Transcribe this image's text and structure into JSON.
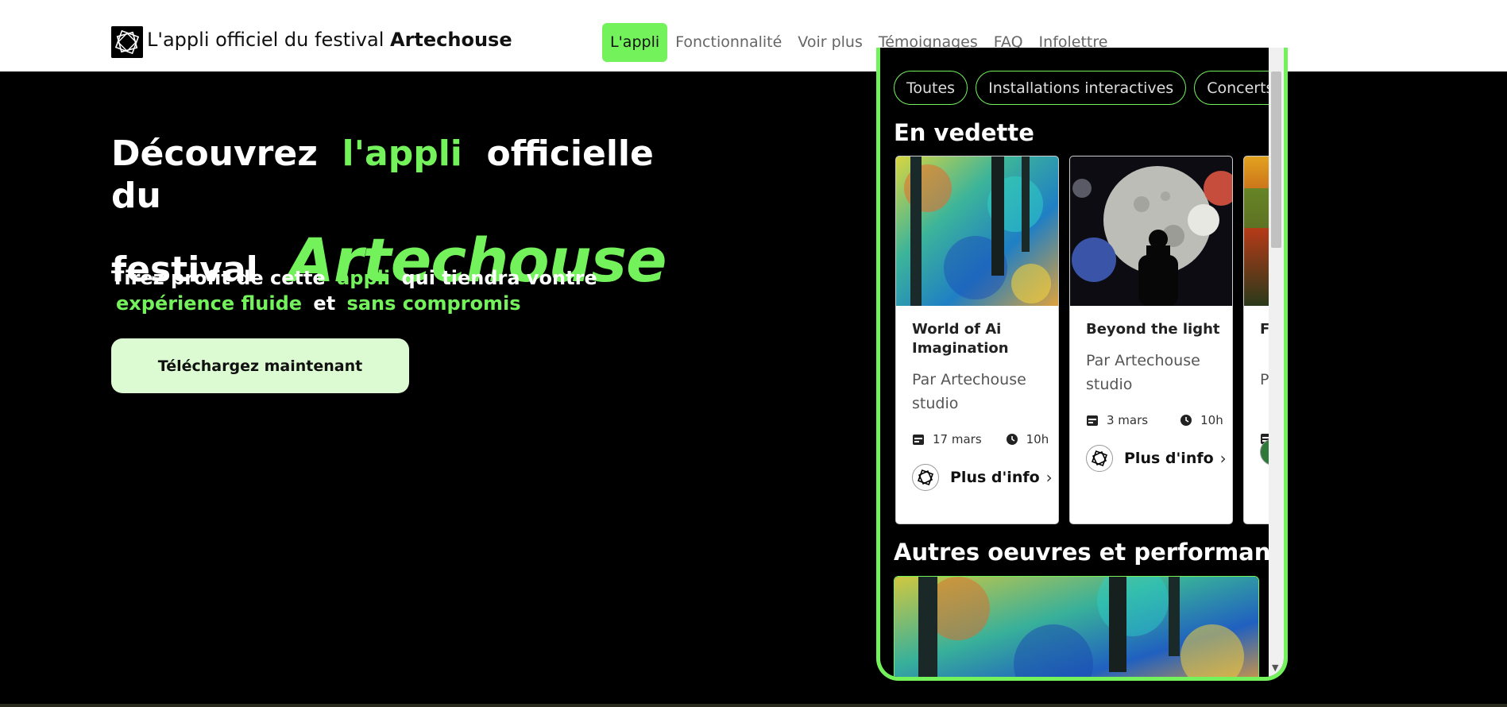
{
  "header": {
    "brand_prefix": "L'appli officiel du festival ",
    "brand_name": "Artechouse",
    "nav": [
      {
        "label": "L'appli",
        "active": true
      },
      {
        "label": "Fonctionnalité"
      },
      {
        "label": "Voir plus"
      },
      {
        "label": "Témoignages"
      },
      {
        "label": "FAQ"
      },
      {
        "label": "Infolettre"
      }
    ]
  },
  "hero": {
    "h1_part1": "Découvrez",
    "h1_highlight": "l'appli",
    "h1_part2": "officielle du",
    "h1_part3": "festival",
    "h1_brand": "Artechouse",
    "sub_part1": "Tirez profit de cette",
    "sub_highlight1": "appli",
    "sub_part2": "qui tiendra vontre",
    "sub_highlight2": "expérience fluide",
    "sub_part3": "et",
    "sub_highlight3": "sans compromis",
    "cta_label": "Téléchargez maintenant"
  },
  "app": {
    "chips": [
      "Toutes",
      "Installations interactives",
      "Concerts"
    ],
    "featured_title": "En vedette",
    "cards": [
      {
        "title": "World of Ai Imagination",
        "by": "Par Artechouse studio",
        "date": "17 mars",
        "time": "10h",
        "more": "Plus d'info"
      },
      {
        "title": "Beyond the light",
        "by": "Par Artechouse studio",
        "date": "3 mars",
        "time": "10h",
        "more": "Plus d'info"
      },
      {
        "title": "F C",
        "by": "P",
        "date": "",
        "time": "",
        "more": ""
      }
    ],
    "others_title": "Autres oeuvres et performances"
  },
  "colors": {
    "accent": "#73f25c",
    "cta_bg": "#ddfbd2",
    "page_bg": "#000000"
  }
}
